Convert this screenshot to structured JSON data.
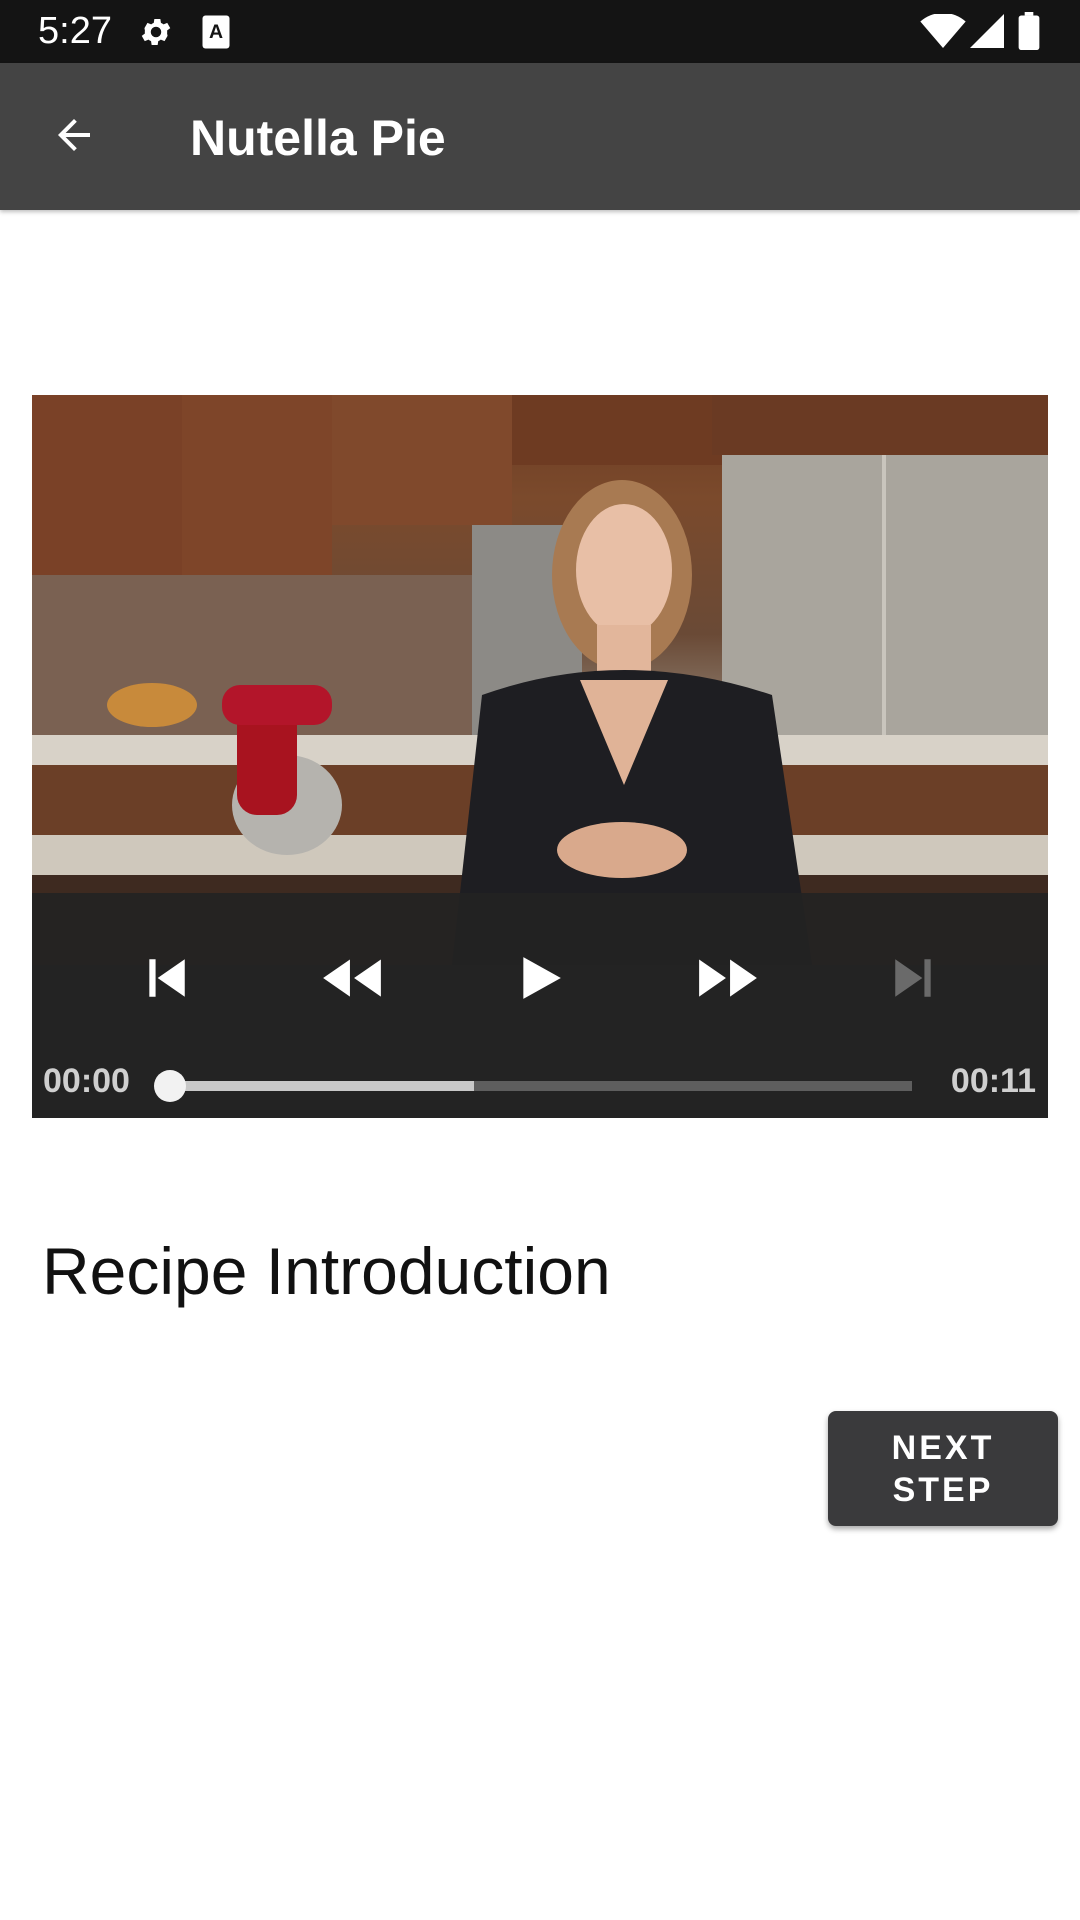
{
  "status_bar": {
    "time": "5:27",
    "left_icons": [
      "gear-icon",
      "text-a-icon"
    ],
    "right_icons": [
      "wifi-icon",
      "signal-icon",
      "battery-icon"
    ]
  },
  "app_bar": {
    "title": "Nutella Pie",
    "back_icon": "arrow-left-icon"
  },
  "player": {
    "controls": [
      "skip-previous-icon",
      "rewind-icon",
      "play-icon",
      "fast-forward-icon",
      "skip-next-icon"
    ],
    "position": "00:00",
    "duration": "00:11",
    "buffered_fraction": 0.41,
    "played_fraction": 0.0,
    "skip_next_enabled": false
  },
  "step": {
    "title": "Recipe Introduction"
  },
  "next_button": {
    "label": "NEXT STEP"
  },
  "colors": {
    "app_bar": "#444444",
    "status_bar": "#141414",
    "player_bg": "#303030",
    "button_bg": "#3a3a3c"
  }
}
